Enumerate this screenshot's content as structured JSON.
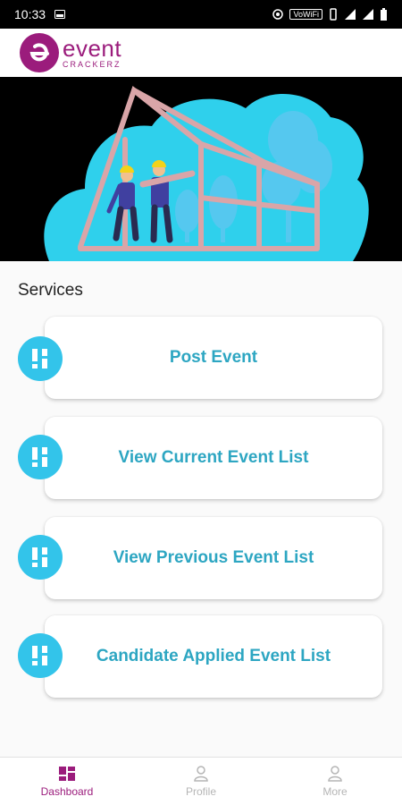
{
  "status_bar": {
    "time": "10:33",
    "network_badge": "VoWiFi"
  },
  "app": {
    "logo_word": "event",
    "logo_sub": "CRACKERZ"
  },
  "services": {
    "title": "Services",
    "items": [
      {
        "label": "Post Event",
        "icon": "grid-icon"
      },
      {
        "label": "View Current Event List",
        "icon": "grid-icon"
      },
      {
        "label": "View Previous Event List",
        "icon": "grid-icon"
      },
      {
        "label": "Candidate Applied Event List",
        "icon": "grid-icon"
      }
    ]
  },
  "bottom_nav": {
    "items": [
      {
        "label": "Dashboard",
        "icon": "dashboard-icon",
        "active": true
      },
      {
        "label": "Profile",
        "icon": "person-icon",
        "active": false
      },
      {
        "label": "More",
        "icon": "person-icon",
        "active": false
      }
    ]
  },
  "colors": {
    "brand": "#9b1c7c",
    "accent": "#2da6c2",
    "icon_bg": "#33c4ea"
  }
}
